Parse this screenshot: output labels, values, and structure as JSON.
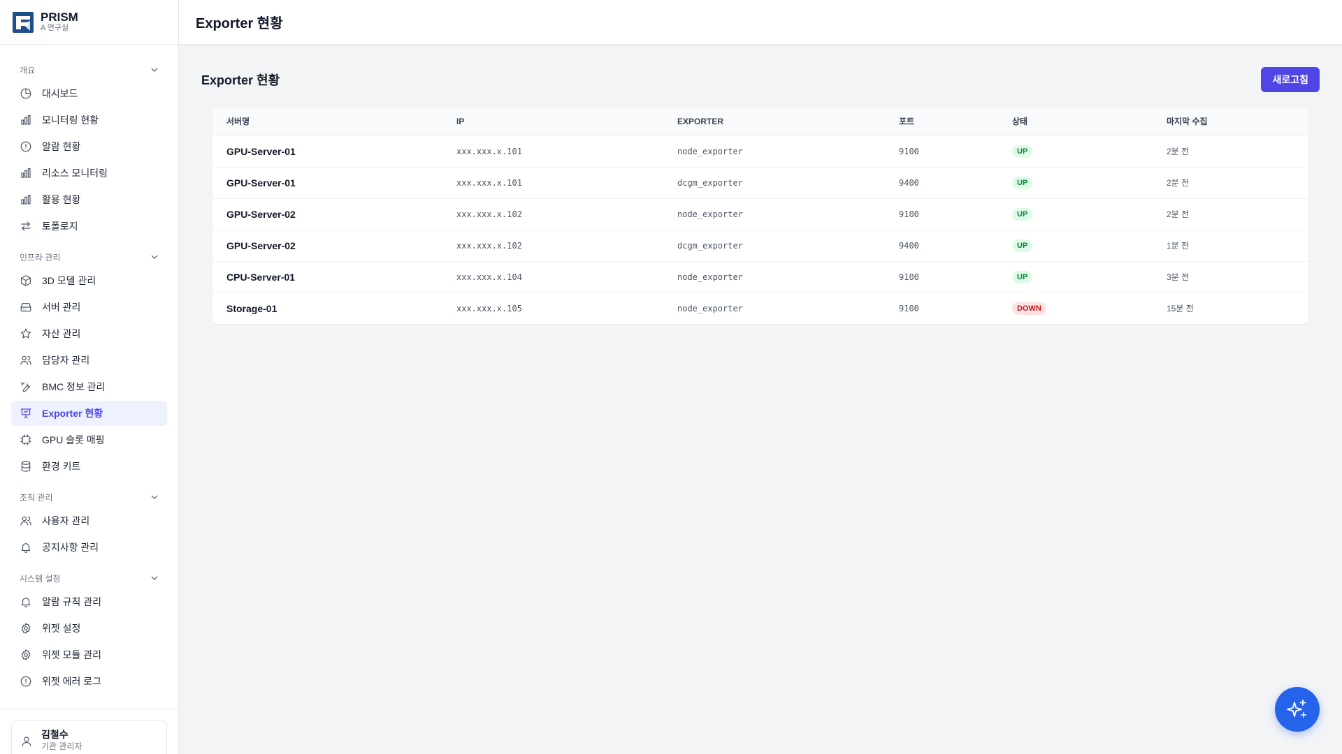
{
  "brand": {
    "name": "PRISM",
    "sub": "A 연구실"
  },
  "sidebar": {
    "sections": [
      {
        "title": "개요",
        "items": [
          "대시보드",
          "모니터링 현황",
          "알람 현황",
          "리소스 모니터링",
          "활용 현황",
          "토폴로지"
        ]
      },
      {
        "title": "인프라 관리",
        "items": [
          "3D 모델 관리",
          "서버 관리",
          "자산 관리",
          "담당자 관리",
          "BMC 정보 관리",
          "Exporter 현황",
          "GPU 슬롯 매핑",
          "환경 키트"
        ]
      },
      {
        "title": "조직 관리",
        "items": [
          "사용자 관리",
          "공지사항 관리"
        ]
      },
      {
        "title": "시스템 설정",
        "items": [
          "알람 규칙 관리",
          "위젯 설정",
          "위젯 모듈 관리",
          "위젯 에러 로그"
        ]
      }
    ],
    "active": "Exporter 현황"
  },
  "user": {
    "name": "김철수",
    "role": "기관 관리자"
  },
  "header": {
    "title": "Exporter 현황"
  },
  "main": {
    "title": "Exporter 현황",
    "refresh_label": "새로고침",
    "table": {
      "columns": [
        "서버명",
        "IP",
        "EXPORTER",
        "포트",
        "상태",
        "마지막 수집"
      ],
      "rows": [
        [
          "GPU-Server-01",
          "xxx.xxx.x.101",
          "node_exporter",
          "9100",
          "UP",
          "2분 전"
        ],
        [
          "GPU-Server-01",
          "xxx.xxx.x.101",
          "dcgm_exporter",
          "9400",
          "UP",
          "2분 전"
        ],
        [
          "GPU-Server-02",
          "xxx.xxx.x.102",
          "node_exporter",
          "9100",
          "UP",
          "2분 전"
        ],
        [
          "GPU-Server-02",
          "xxx.xxx.x.102",
          "dcgm_exporter",
          "9400",
          "UP",
          "1분 전"
        ],
        [
          "CPU-Server-01",
          "xxx.xxx.x.104",
          "node_exporter",
          "9100",
          "UP",
          "3분 전"
        ],
        [
          "Storage-01",
          "xxx.xxx.x.105",
          "node_exporter",
          "9100",
          "DOWN",
          "15분 전"
        ]
      ]
    }
  },
  "colors": {
    "accent": "#4f46e5",
    "fab": "#2563eb",
    "up": "#15803d",
    "down": "#b91c1c"
  }
}
